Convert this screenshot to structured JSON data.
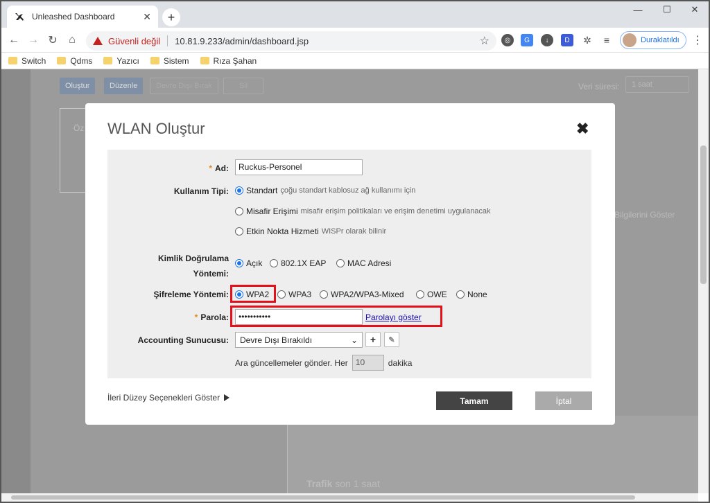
{
  "browser": {
    "tab_title": "Unleashed Dashboard",
    "tab_close": "✕",
    "new_tab": "+",
    "security_label": "Güvenli değil",
    "url": "10.81.9.233/admin/dashboard.jsp",
    "profile_label": "Duraklatıldı",
    "bookmarks": [
      "Switch",
      "Qdms",
      "Yazıcı",
      "Sistem",
      "Rıza Şahan"
    ]
  },
  "background": {
    "buttons": [
      "Oluştur",
      "Düzenle",
      "Devre Dışı Bırak",
      "Sil"
    ],
    "period_label": "Veri süresi:",
    "period_value": "1 saat",
    "box_label": "Öz",
    "show_info_link": "Bilgilerini Göster",
    "traffic_title": "Trafik",
    "traffic_sub": "son 1 saat"
  },
  "modal": {
    "title": "WLAN Oluştur",
    "close": "✖",
    "name_label": "Ad:",
    "name_value": "Ruckus-Personel",
    "usage_label": "Kullanım Tipi:",
    "usage_options": [
      {
        "label": "Standart",
        "desc": "çoğu standart kablosuz ağ kullanımı için",
        "selected": true
      },
      {
        "label": "Misafir Erişimi",
        "desc": "misafir erişim politikaları ve erişim denetimi uygulanacak",
        "selected": false
      },
      {
        "label": "Etkin Nokta Hizmeti",
        "desc": "WISPr olarak bilinir",
        "selected": false
      }
    ],
    "auth_label_1": "Kimlik Doğrulama",
    "auth_label_2": "Yöntemi:",
    "auth_options": [
      {
        "label": "Açık",
        "selected": true
      },
      {
        "label": "802.1X EAP",
        "selected": false
      },
      {
        "label": "MAC Adresi",
        "selected": false
      }
    ],
    "encryption_label": "Şifreleme Yöntemi:",
    "encryption_options": [
      {
        "label": "WPA2",
        "selected": true
      },
      {
        "label": "WPA3",
        "selected": false
      },
      {
        "label": "WPA2/WPA3-Mixed",
        "selected": false
      },
      {
        "label": "OWE",
        "selected": false
      },
      {
        "label": "None",
        "selected": false
      }
    ],
    "password_label": "Parola:",
    "password_value": "•••••••••••",
    "show_password": "Parolayı göster",
    "accounting_label": "Accounting Sunucusu:",
    "accounting_value": "Devre Dışı Bırakıldı",
    "interim_prefix": "Ara güncellemeler gönder. Her",
    "interim_value": "10",
    "interim_suffix": "dakika",
    "advanced": "İleri Düzey Seçenekleri Göster",
    "ok": "Tamam",
    "cancel": "İptal"
  },
  "colors": {
    "highlight": "#e3101a",
    "radio_selected": "#1a73e8",
    "ok_button": "#444444"
  }
}
